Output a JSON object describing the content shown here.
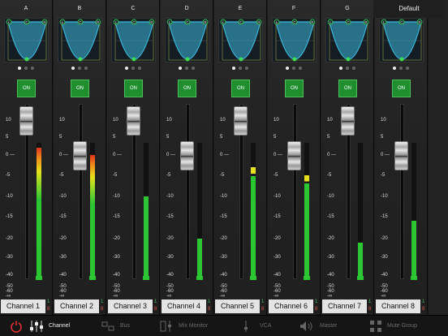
{
  "header": {
    "preset_label": "Default"
  },
  "eq_button_labels": {
    "low": "L",
    "center": "C",
    "right": "R"
  },
  "on_label": "ON",
  "scale": [
    "10",
    "5",
    "0",
    "-5",
    "-10",
    "-15",
    "-20",
    "-30",
    "-40",
    "-50",
    "-60",
    "-∞"
  ],
  "strips": [
    {
      "label": "A",
      "name": "Channel 1",
      "num_top": "1",
      "num_bottom": "8",
      "fader_db": 10,
      "meter_db": 2,
      "peak": "red"
    },
    {
      "label": "B",
      "name": "Channel 2",
      "num_top": "1",
      "num_bottom": "8",
      "fader_db": 0,
      "meter_db": 0,
      "peak": "red"
    },
    {
      "label": "C",
      "name": "Channel 3",
      "num_top": "1",
      "num_bottom": "8",
      "fader_db": 10,
      "meter_db": -10,
      "peak": "none"
    },
    {
      "label": "D",
      "name": "Channel 4",
      "num_top": "1",
      "num_bottom": "8",
      "fader_db": 0,
      "meter_db": -20,
      "peak": "none"
    },
    {
      "label": "E",
      "name": "Channel 5",
      "num_top": "1",
      "num_bottom": "8",
      "fader_db": 10,
      "meter_db": -3,
      "peak": "yellow"
    },
    {
      "label": "F",
      "name": "Channel 6",
      "num_top": "1",
      "num_bottom": "8",
      "fader_db": 0,
      "meter_db": -5,
      "peak": "yellow"
    },
    {
      "label": "G",
      "name": "Channel 7",
      "num_top": "1",
      "num_bottom": "8",
      "fader_db": 10,
      "meter_db": -22,
      "peak": "none"
    },
    {
      "label": "",
      "name": "Channel 8",
      "num_top": "1",
      "num_bottom": "8",
      "fader_db": 0,
      "meter_db": -16,
      "peak": "none"
    }
  ],
  "toolbar": {
    "channel": "Channel",
    "bus": "Bus",
    "mix_monitor": "Mix Monitor",
    "vca": "VCA",
    "master": "Master",
    "mute_group": "Mute Group"
  },
  "colors": {
    "on_green": "#1f8e2e",
    "meter_green": "#2cc534",
    "meter_yellow": "#e8e01b",
    "meter_red": "#e0331b",
    "eq_cyan": "#3bb6da"
  }
}
